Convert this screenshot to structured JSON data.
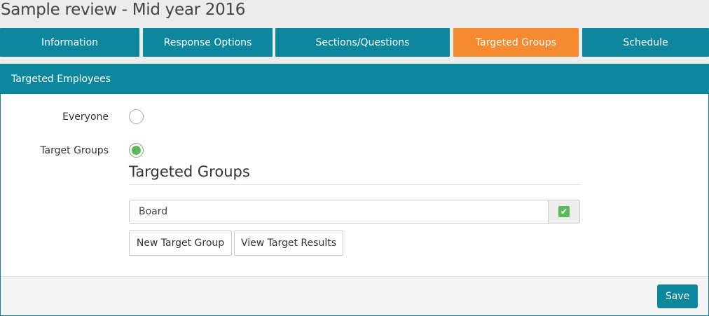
{
  "page": {
    "title": "Sample review - Mid year 2016"
  },
  "tabs": [
    {
      "label": "Information",
      "active": false
    },
    {
      "label": "Response Options",
      "active": false
    },
    {
      "label": "Sections/Questions",
      "active": false
    },
    {
      "label": "Targeted Groups",
      "active": true
    },
    {
      "label": "Schedule",
      "active": false
    }
  ],
  "panel": {
    "header": "Targeted Employees",
    "options": [
      {
        "label": "Everyone",
        "selected": false
      },
      {
        "label": "Target Groups",
        "selected": true
      }
    ],
    "section_title": "Targeted Groups",
    "group_input": {
      "value": "Board",
      "checked": true,
      "check_icon": "check-icon"
    },
    "buttons": {
      "new_group": "New Target Group",
      "view_results": "View Target Results"
    },
    "footer": {
      "save": "Save"
    }
  },
  "colors": {
    "primary": "#0d879e",
    "active_tab": "#f58a2f",
    "success": "#5cb85c"
  }
}
